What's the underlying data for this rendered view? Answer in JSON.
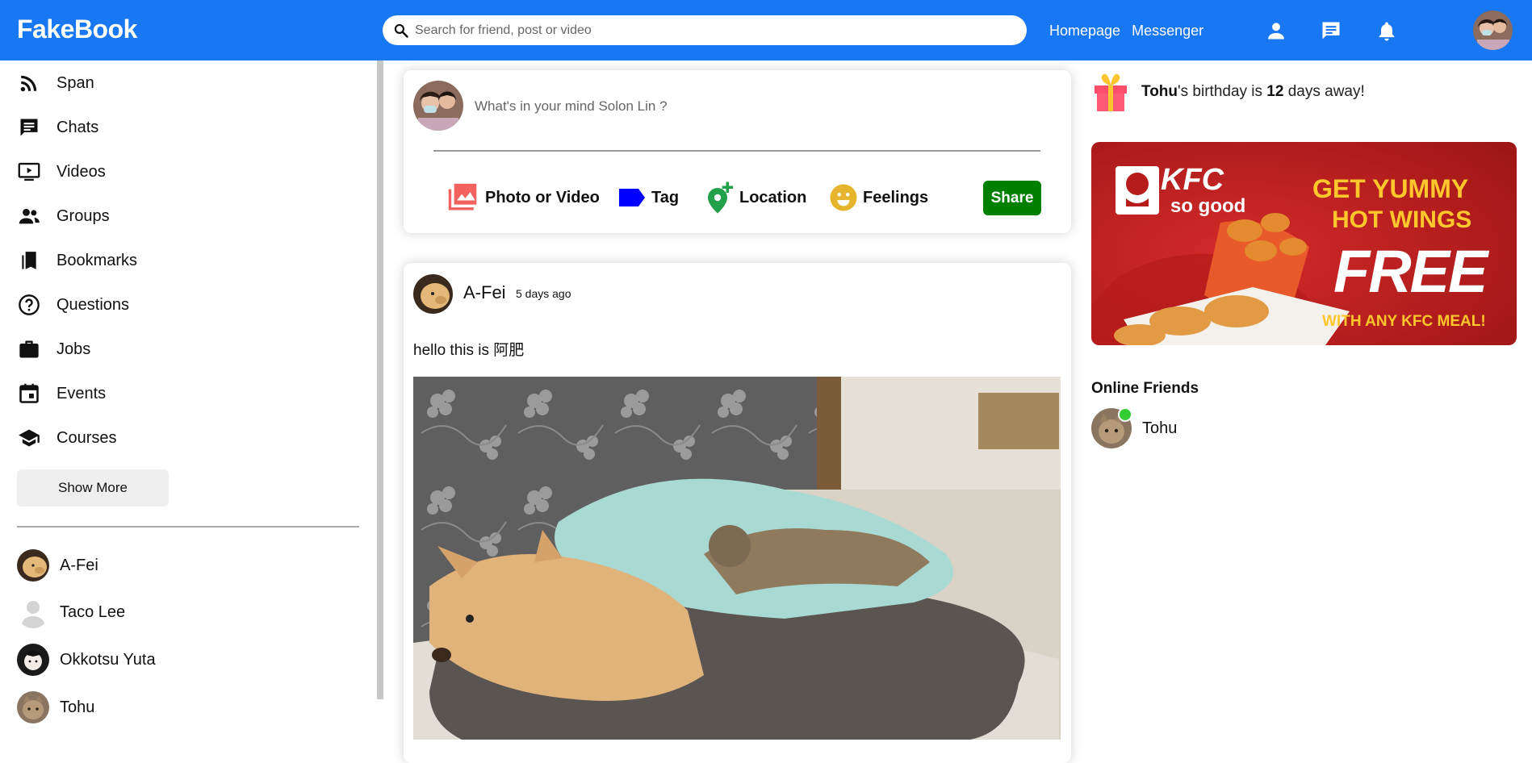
{
  "app": {
    "logo": "FakeBook"
  },
  "colors": {
    "brand_blue": "#1877f2",
    "share_green": "#008000",
    "online_green": "#32cd32",
    "tag_blue": "#0000ff",
    "photo_red": "#f3625e",
    "location_green": "#23a04a",
    "feelings_gold": "#e6b52d"
  },
  "topbar": {
    "search_placeholder": "Search for friend, post or video",
    "links": [
      "Homepage",
      "Messenger"
    ],
    "icons": [
      "person-icon",
      "chat-icon",
      "notifications-icon"
    ]
  },
  "sidebar": {
    "items": [
      {
        "label": "Span",
        "icon": "rss-feed-icon"
      },
      {
        "label": "Chats",
        "icon": "chat-icon"
      },
      {
        "label": "Videos",
        "icon": "video-icon"
      },
      {
        "label": "Groups",
        "icon": "groups-icon"
      },
      {
        "label": "Bookmarks",
        "icon": "bookmarks-icon"
      },
      {
        "label": "Questions",
        "icon": "help-icon"
      },
      {
        "label": "Jobs",
        "icon": "briefcase-icon"
      },
      {
        "label": "Events",
        "icon": "calendar-icon"
      },
      {
        "label": "Courses",
        "icon": "school-icon"
      }
    ],
    "show_more": "Show More",
    "friends": [
      {
        "name": "A-Fei"
      },
      {
        "name": "Taco Lee"
      },
      {
        "name": "Okkotsu Yuta"
      },
      {
        "name": "Tohu"
      }
    ]
  },
  "share": {
    "placeholder": "What's in your mind Solon Lin ?",
    "options": [
      {
        "label": "Photo or Video",
        "icon": "photo-library-icon"
      },
      {
        "label": "Tag",
        "icon": "label-icon"
      },
      {
        "label": "Location",
        "icon": "add-location-icon"
      },
      {
        "label": "Feelings",
        "icon": "emoji-icon"
      }
    ],
    "button": "Share"
  },
  "post": {
    "author": "A-Fei",
    "time": "5 days ago",
    "text": "hello this is 阿肥"
  },
  "right": {
    "birthday": {
      "name": "Tohu",
      "mid": "'s birthday is ",
      "days": "12",
      "tail": " days away!"
    },
    "ad": {
      "brand": "KFC",
      "brand_sub": "so good",
      "line1": "GET YUMMY",
      "line2": "HOT WINGS",
      "line3": "FREE",
      "line4": "WITH ANY KFC MEAL!"
    },
    "online_title": "Online Friends",
    "online_friends": [
      {
        "name": "Tohu"
      }
    ]
  }
}
